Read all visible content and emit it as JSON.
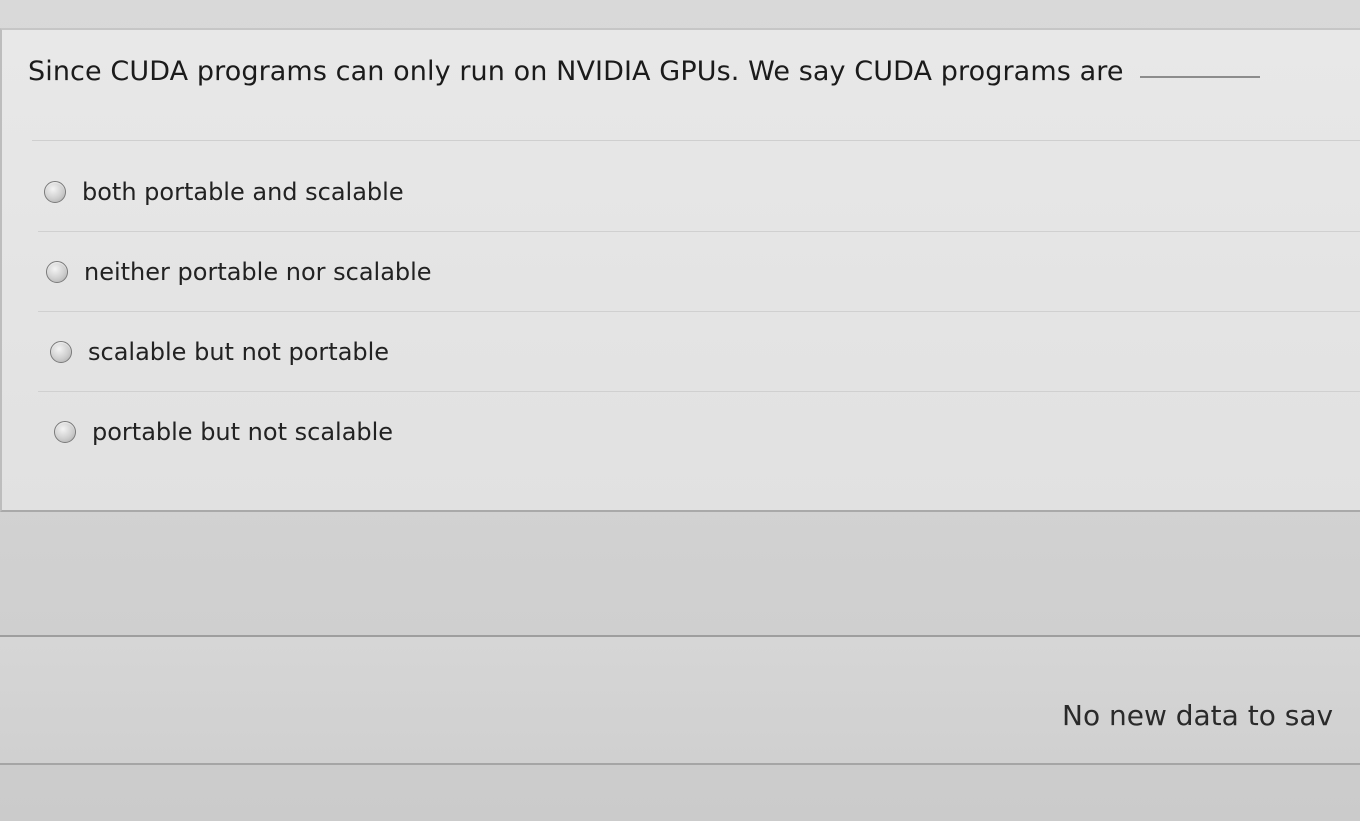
{
  "question": {
    "text": "Since CUDA programs can only run on NVIDIA GPUs. We say CUDA programs are"
  },
  "answers": [
    {
      "label": "both portable and scalable"
    },
    {
      "label": "neither portable nor scalable"
    },
    {
      "label": "scalable but not portable"
    },
    {
      "label": "portable but not scalable"
    }
  ],
  "footer": {
    "save_status": "No new data to sav"
  }
}
